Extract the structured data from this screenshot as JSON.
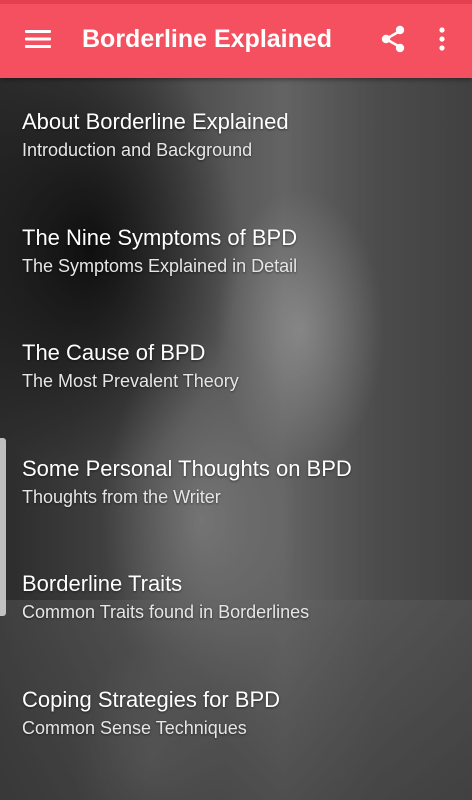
{
  "app_bar": {
    "title": "Borderline Explained",
    "background_color": "#f4505f",
    "menu_icon": "hamburger-menu-icon",
    "share_icon": "share-icon",
    "more_icon": "more-vertical-icon"
  },
  "menu": {
    "items": [
      {
        "title": "About Borderline Explained",
        "subtitle": "Introduction and Background"
      },
      {
        "title": "The Nine Symptoms of BPD",
        "subtitle": "The Symptoms Explained in Detail"
      },
      {
        "title": "The Cause of BPD",
        "subtitle": "The Most Prevalent Theory"
      },
      {
        "title": "Some Personal Thoughts on BPD",
        "subtitle": "Thoughts from the Writer"
      },
      {
        "title": "Borderline Traits",
        "subtitle": "Common Traits found in Borderlines"
      },
      {
        "title": "Coping Strategies for BPD",
        "subtitle": "Common Sense Techniques"
      }
    ]
  }
}
